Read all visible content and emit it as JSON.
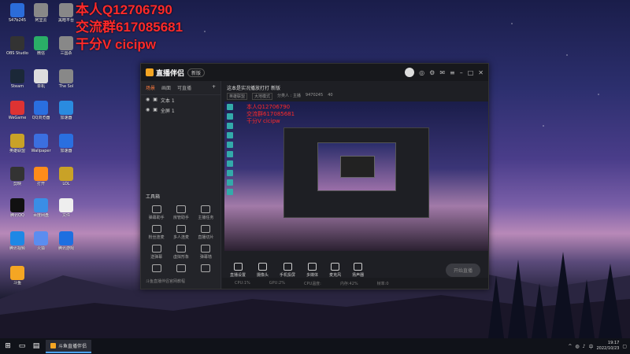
{
  "promo_lines": [
    "本人Q12706790",
    "交流群617085681",
    "干分V cicipw"
  ],
  "desktop_icons": [
    {
      "label": "S47b245",
      "color": "#2b6cd9"
    },
    {
      "label": "阿里云"
    },
    {
      "label": "黑暗平台"
    },
    {
      "label": "OBS Studio",
      "color": "#333"
    },
    {
      "label": "微信",
      "color": "#2aae67"
    },
    {
      "label": "三国杀"
    },
    {
      "label": "Steam",
      "color": "#1b2838"
    },
    {
      "label": "单机",
      "color": "#ddd"
    },
    {
      "label": "The Sol"
    },
    {
      "label": "WeGame",
      "color": "#d33"
    },
    {
      "label": "QQ浏览器",
      "color": "#2a6fe0"
    },
    {
      "label": "加速器",
      "color": "#2a8be0"
    },
    {
      "label": "英雄联盟",
      "color": "#c9a227"
    },
    {
      "label": "Wallpaper",
      "color": "#3b6fe0"
    },
    {
      "label": "加速器",
      "color": "#2a6fe0"
    },
    {
      "label": "剪映",
      "color": "#333"
    },
    {
      "label": "打开",
      "color": "#ff8c1a"
    },
    {
      "label": "LOL",
      "color": "#c9a227"
    },
    {
      "label": "腾讯QQ",
      "color": "#111"
    },
    {
      "label": "百度网盘",
      "color": "#3a8ee6"
    },
    {
      "label": "文件",
      "color": "#eee"
    },
    {
      "label": "腾讯视频",
      "color": "#1e88e5"
    },
    {
      "label": "火狐",
      "color": "#5b8def"
    },
    {
      "label": "腾讯游戏",
      "color": "#1e6fe0"
    },
    {
      "label": "斗鱼",
      "color": "#f5a623"
    }
  ],
  "app": {
    "name": "直播伴侣",
    "version": "新版",
    "sidebar_tabs": [
      "场景",
      "画面",
      "可直播"
    ],
    "scenes": [
      "文本 1",
      "全屏 1"
    ],
    "tools_title": "工具箱",
    "tools": [
      "弹幕助手",
      "房管助手",
      "主播任务",
      "粉丝连麦",
      "多人连麦",
      "直播切片",
      "送弹幕",
      "虚拟形象",
      "弹幕墙",
      "",
      "",
      ""
    ],
    "footer": "斗鱼直播伴侣官网教程",
    "stream_title": "这本是实况播放打打",
    "stream_badge": "新版",
    "stream_meta": [
      "英雄联盟",
      "大地模式",
      "分类人 : 主播",
      "9470245",
      "40"
    ],
    "preview_text": [
      "本人Q12706790",
      "交流群617085681",
      "干分V cicipw"
    ],
    "controls": [
      "直播设置",
      "摄像头",
      "手机投屏",
      "多媒体",
      "麦克风",
      "扬声器"
    ],
    "go_live": "开始直播",
    "status": [
      "CPU:1%",
      "GPU:2%",
      "CPU温度:",
      "内存:42%",
      "帧率:0"
    ]
  },
  "taskbar": {
    "task_label": "斗鱼直播伴侣",
    "time": "19:17",
    "date": "2022/10/23"
  }
}
